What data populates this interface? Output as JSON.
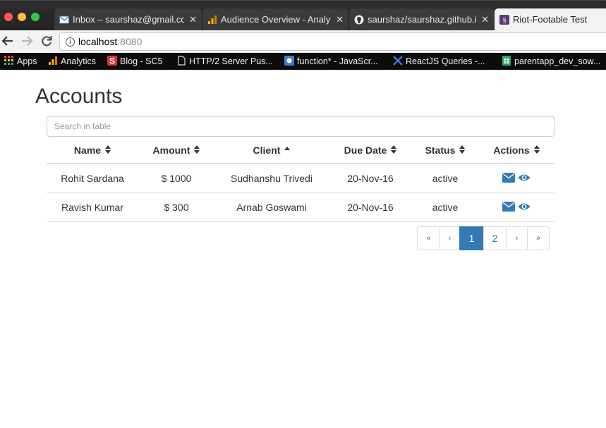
{
  "browser": {
    "tabs": [
      {
        "title": "Inbox – saurshaz@gmail.co",
        "close": "✕"
      },
      {
        "title": "Audience Overview - Analyt",
        "close": "✕"
      },
      {
        "title": "saurshaz/saurshaz.github.i",
        "close": "✕"
      },
      {
        "title": "Riot-Footable Test"
      }
    ],
    "address": {
      "host": "localhost",
      "port": ":8080"
    },
    "bookmarks": [
      {
        "label": "Apps"
      },
      {
        "label": "Analytics"
      },
      {
        "label": "Blog - SC5"
      },
      {
        "label": "HTTP/2 Server Pus..."
      },
      {
        "label": "function* - JavaScr..."
      },
      {
        "label": "ReactJS Queries -..."
      },
      {
        "label": "parentapp_dev_sow..."
      }
    ]
  },
  "page": {
    "title": "Accounts",
    "search_placeholder": "Search in table"
  },
  "table": {
    "columns": [
      {
        "label": "Name",
        "sort": "both"
      },
      {
        "label": "Amount",
        "sort": "both"
      },
      {
        "label": "Client",
        "sort": "asc"
      },
      {
        "label": "Due Date",
        "sort": "both"
      },
      {
        "label": "Status",
        "sort": "both"
      },
      {
        "label": "Actions",
        "sort": "both"
      }
    ],
    "rows": [
      {
        "name": "Rohit Sardana",
        "amount": "$ 1000",
        "client": "Sudhanshu Trivedi",
        "due_date": "20-Nov-16",
        "status": "active"
      },
      {
        "name": "Ravish Kumar",
        "amount": "$ 300",
        "client": "Arnab Goswami",
        "due_date": "20-Nov-16",
        "status": "active"
      }
    ],
    "action_icons": [
      "envelope-icon",
      "eye-icon"
    ]
  },
  "pagination": {
    "first": "«",
    "prev": "‹",
    "pages": [
      "1",
      "2"
    ],
    "current_page": "1",
    "next": "›",
    "last": "»"
  },
  "colors": {
    "accent": "#337ab7",
    "tab_bar": "#2d2d2d",
    "bookmarks_bar": "#0c0c0c"
  }
}
